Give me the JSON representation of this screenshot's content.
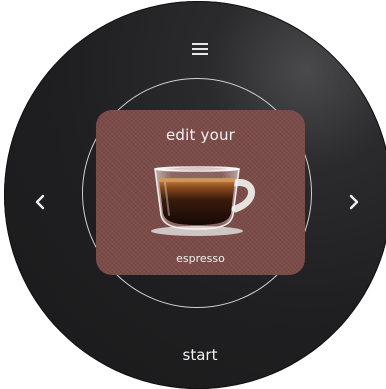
{
  "menu": {
    "icon": "hamburger-menu-icon"
  },
  "navigation": {
    "prev_icon": "chevron-left-icon",
    "next_icon": "chevron-right-icon"
  },
  "screen": {
    "title": "edit your",
    "drink": "espresso",
    "image_icon": "espresso-cup-icon",
    "background_color": "#7a4b48"
  },
  "actions": {
    "start_label": "start"
  },
  "colors": {
    "dial": "#1f1f21",
    "ring": "#cfcfcf",
    "text": "#f2f2f2"
  }
}
